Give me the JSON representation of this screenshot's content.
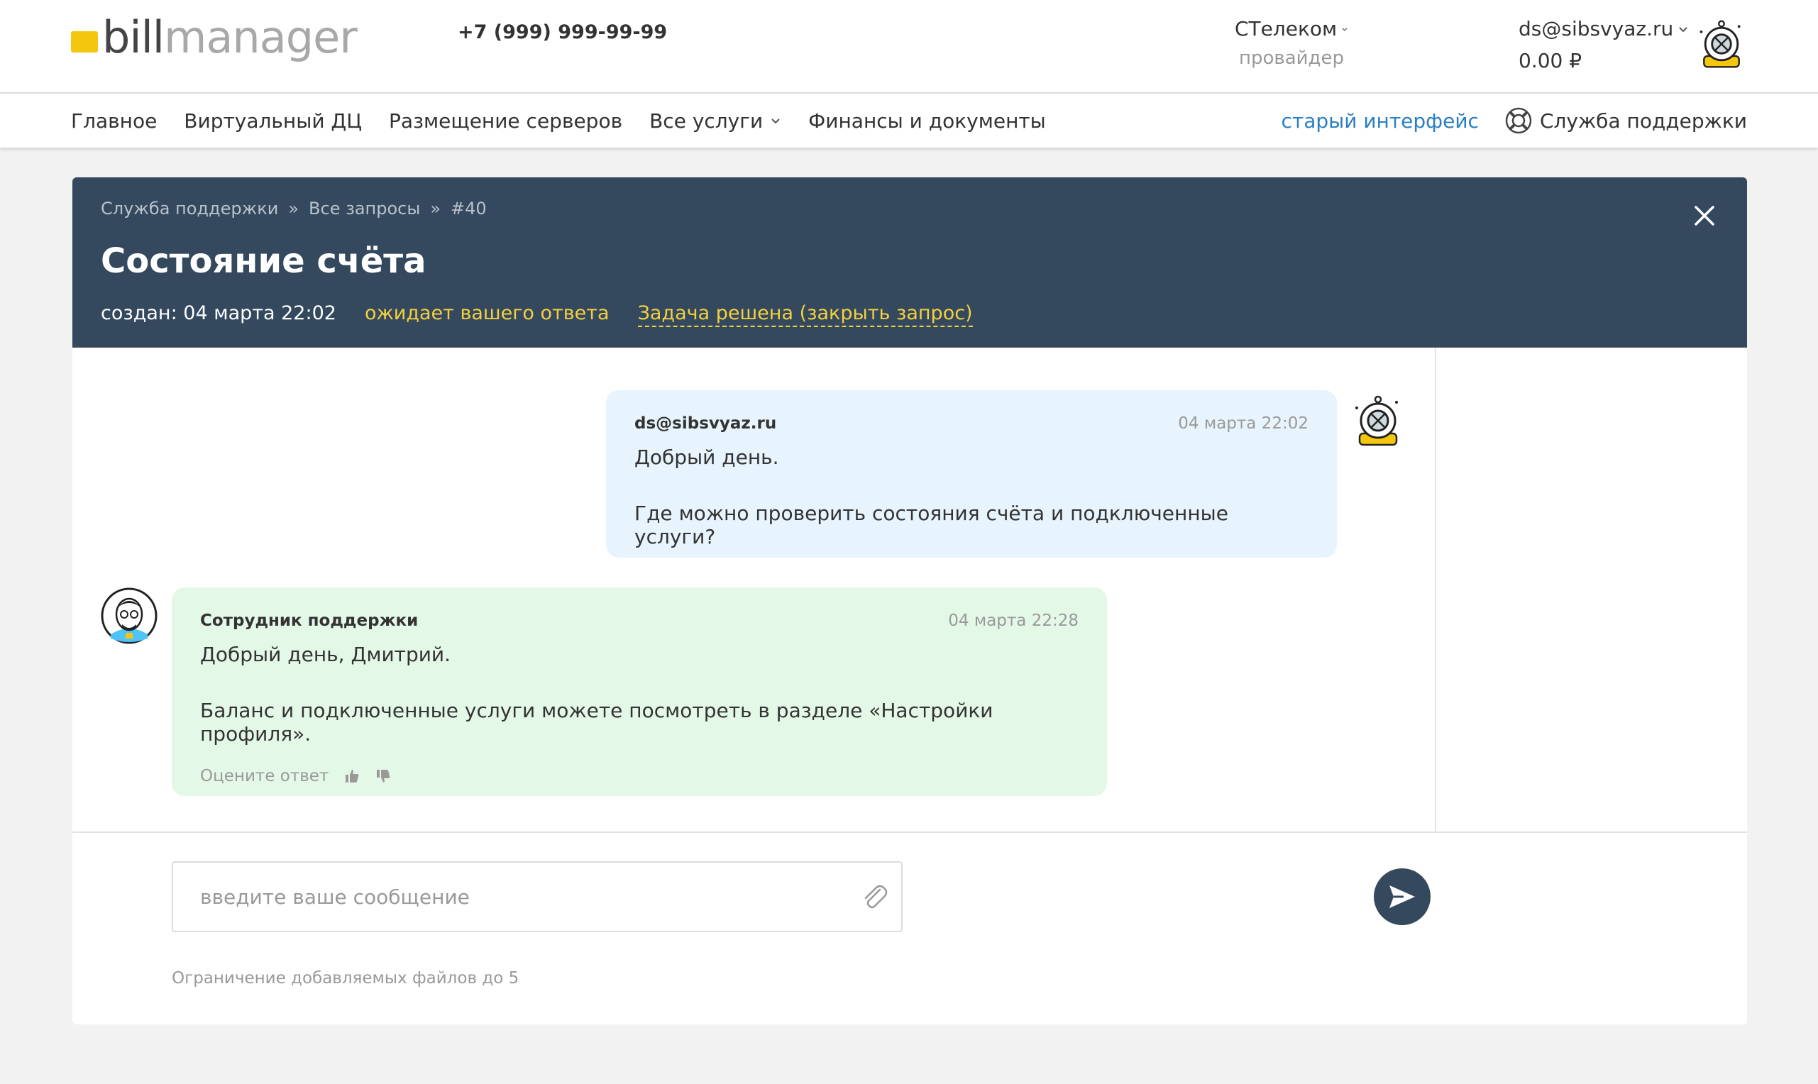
{
  "header": {
    "logo_bill": "bill",
    "logo_manager": "manager",
    "phone": "+7 (999) 999-99-99",
    "provider_name": "СТелеком",
    "provider_sub": "провайдер",
    "account_email": "ds@sibsvyaz.ru",
    "account_balance": "0.00 ₽"
  },
  "nav": {
    "items": [
      "Главное",
      "Виртуальный ДЦ",
      "Размещение серверов",
      "Все услуги",
      "Финансы и документы"
    ],
    "old_interface": "старый интерфейс",
    "support": "Служба поддержки"
  },
  "ticket": {
    "breadcrumb": [
      "Служба поддержки",
      "»",
      "Все запросы",
      "»",
      "#40"
    ],
    "title": "Состояние счёта",
    "created": "создан: 04 марта 22:02",
    "status": "ожидает вашего ответа",
    "resolve": "Задача решена (закрыть запрос)"
  },
  "messages": [
    {
      "author": "ds@sibsvyaz.ru",
      "time": "04 марта 22:02",
      "line1": "Добрый день.",
      "line2": "Где можно проверить состояния счёта и подключенные услуги?"
    },
    {
      "author": "Сотрудник поддержки",
      "time": "04 марта 22:28",
      "line1": "Добрый день, Дмитрий.",
      "line2": "Баланс и подключенные услуги можете посмотреть в разделе «Настройки профиля».",
      "rate_label": "Оцените ответ"
    }
  ],
  "compose": {
    "placeholder": "введите ваше сообщение",
    "limit_note": "Ограничение добавляемых файлов до 5"
  },
  "icons": {
    "chevron": "chevron-down-icon",
    "support": "lifebuoy-icon",
    "close": "close-icon",
    "attach": "paperclip-icon",
    "send": "send-icon"
  },
  "colors": {
    "header_dark": "#34495e",
    "accent_yellow": "#f4d03f",
    "link_blue": "#2a7fc4",
    "user_bubble": "#e8f4fd",
    "staff_bubble": "#e4f8e8"
  }
}
